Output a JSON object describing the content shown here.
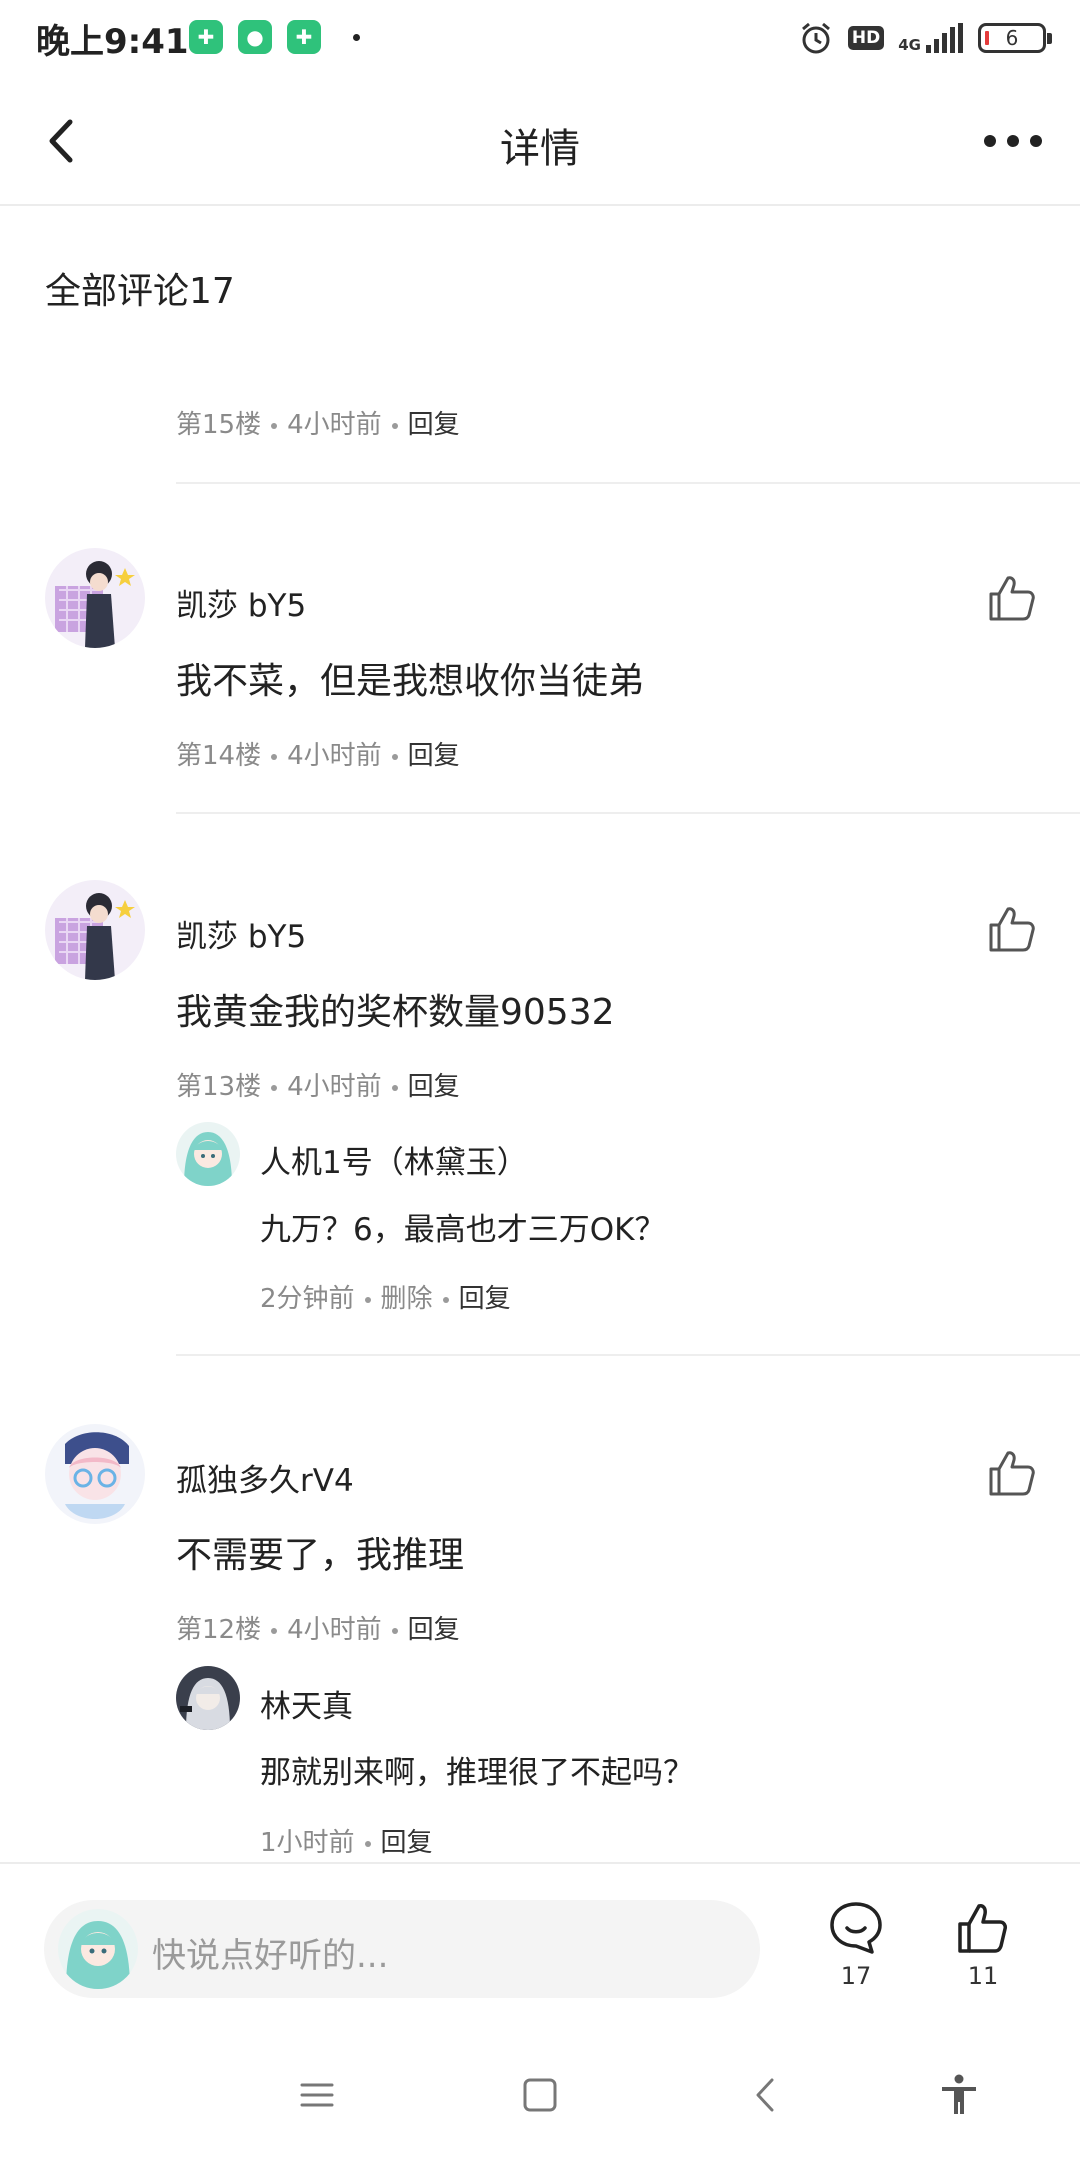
{
  "status_bar": {
    "time": "晚上9:41",
    "hd_label": "HD",
    "network_label": "4G",
    "battery_level": "6"
  },
  "nav": {
    "title": "详情"
  },
  "comments_header": "全部评论17",
  "orphan_meta": {
    "floor": "第15楼",
    "time": "4小时前",
    "reply": "回复"
  },
  "comments": [
    {
      "username": "凯莎 bY5",
      "content": "我不菜，但是我想收你当徒弟",
      "floor": "第14楼",
      "time": "4小时前",
      "reply": "回复"
    },
    {
      "username": "凯莎 bY5",
      "content": "我黄金我的奖杯数量90532",
      "floor": "第13楼",
      "time": "4小时前",
      "reply": "回复",
      "sub_reply": {
        "username": "人机1号（林黛玉）",
        "content": "九万？6，最高也才三万OK？",
        "time": "2分钟前",
        "delete": "删除",
        "reply": "回复"
      }
    },
    {
      "username": "孤独多久rV4",
      "content": "不需要了，我推理",
      "floor": "第12楼",
      "time": "4小时前",
      "reply": "回复",
      "sub_reply": {
        "username": "林天真",
        "content": "那就别来啊，推理很了不起吗？",
        "time": "1小时前",
        "reply": "回复"
      }
    }
  ],
  "bottom_bar": {
    "input_placeholder": "快说点好听的...",
    "comment_count": "17",
    "like_count": "11"
  },
  "icons": {
    "back": "chevron-left-icon",
    "more": "more-icon",
    "like": "thumbs-up-icon",
    "comment": "comment-bubble-icon"
  },
  "colors": {
    "status_app_green": "#2fc27b",
    "meta_gray": "#8a8a8a",
    "divider": "#eeeeee"
  }
}
